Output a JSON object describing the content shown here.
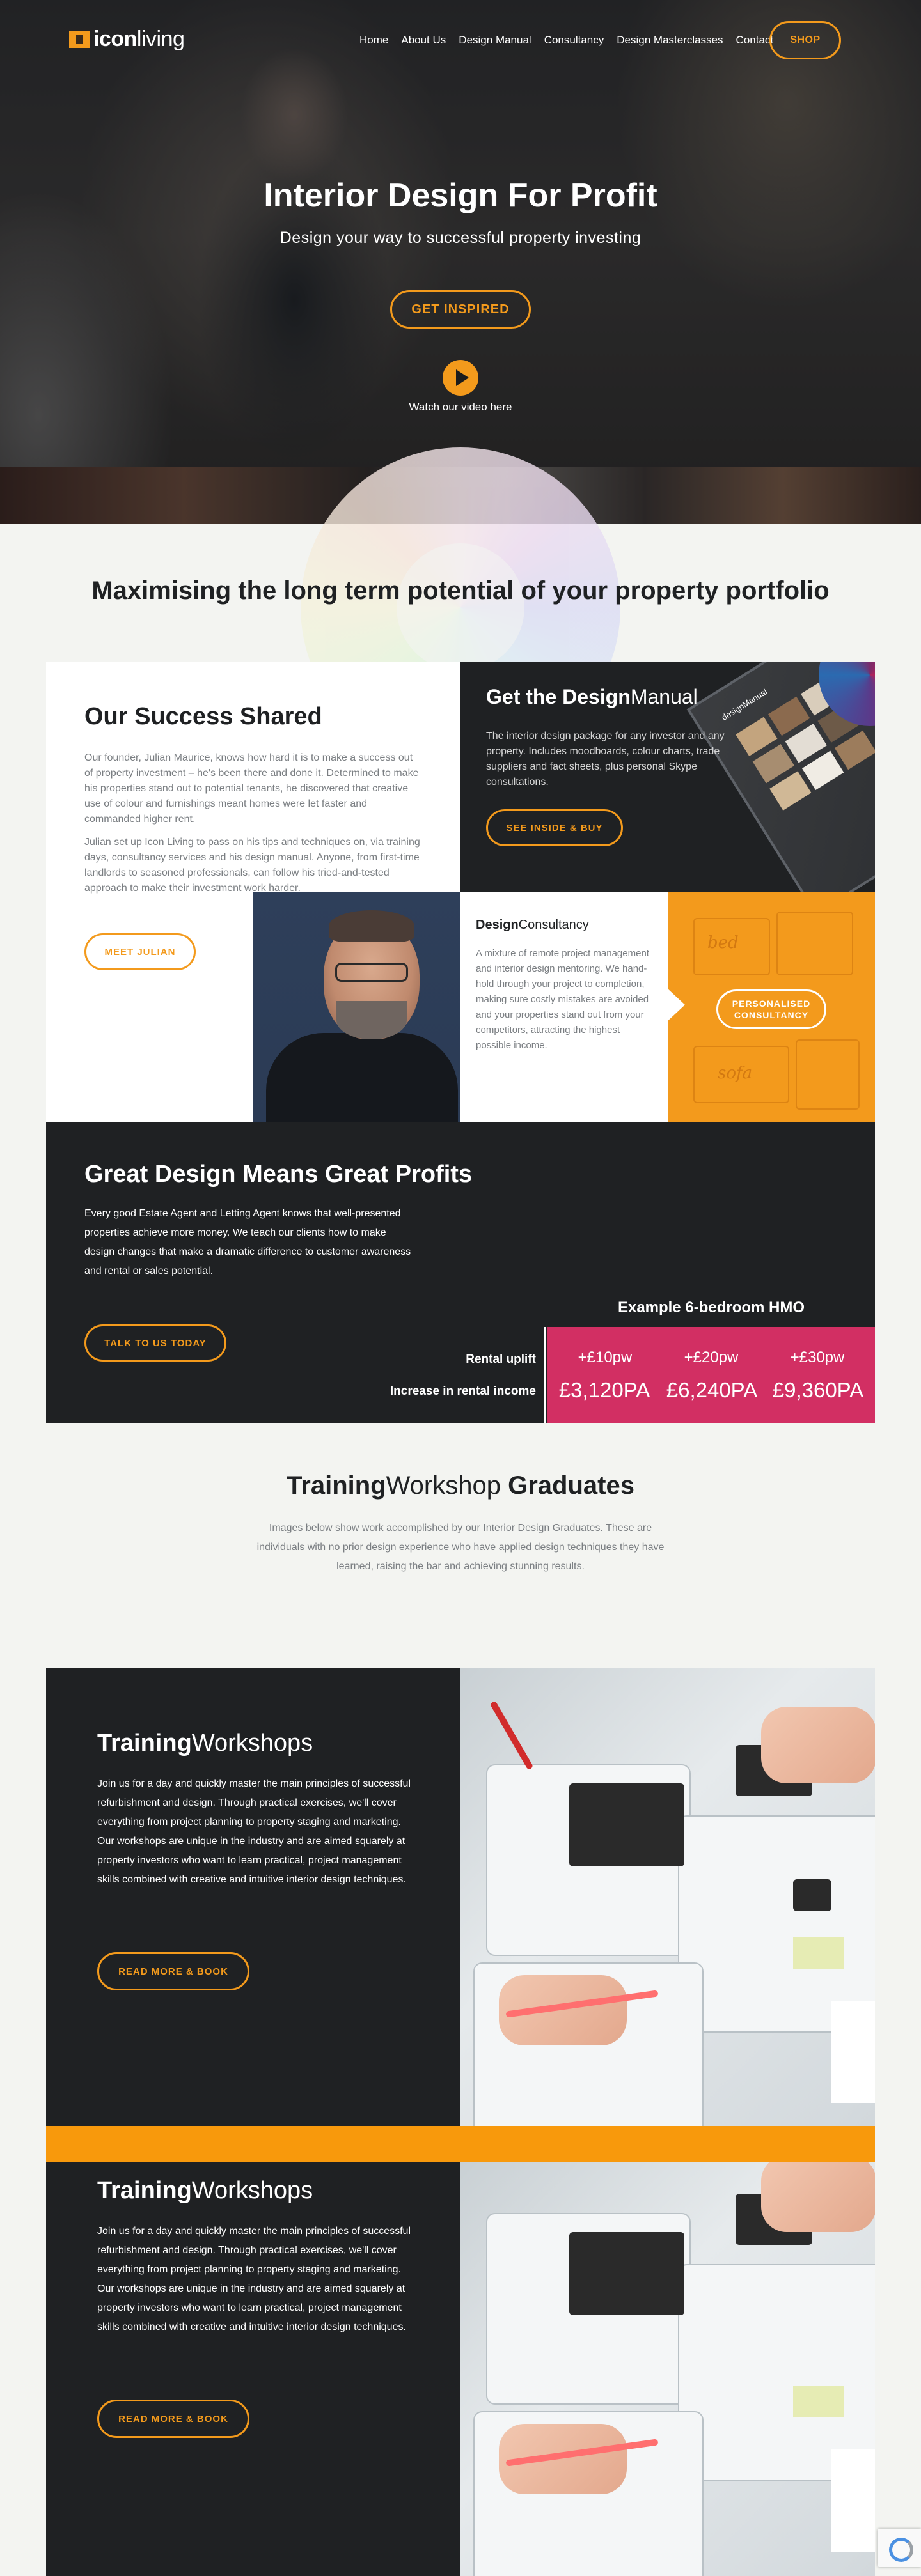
{
  "nav": {
    "brand_bold": "icon",
    "brand_light": "living",
    "links": [
      "Home",
      "About Us",
      "Design Manual",
      "Consultancy",
      "Design Masterclasses",
      "Contact"
    ],
    "shop": "SHOP"
  },
  "hero": {
    "title": "Interior Design For Profit",
    "subtitle": "Design your way to successful property investing",
    "cta": "GET INSPIRED",
    "video_text": "Watch our video here"
  },
  "intro": {
    "title": "Maximising the long term potential of your property portfolio"
  },
  "success": {
    "title": "Our Success Shared",
    "para1": "Our founder, Julian Maurice, knows how hard it is to make a success out of property investment – he's been there and done it. Determined to make his properties stand out to potential tenants, he discovered that creative use of colour and furnishings meant homes were let faster and commanded higher rent.",
    "para2": "Julian set up Icon Living to pass on his tips and techniques on, via training days, consultancy services and his design manual. Anyone, from first-time landlords to seasoned professionals, can follow his tried-and-tested approach to make their investment work harder.",
    "button": "MEET JULIAN"
  },
  "manual": {
    "title_bold": "Get the Design",
    "title_light": "Manual",
    "text": "The interior design package for any investor and any property. Includes moodboards, colour charts, trade suppliers and fact sheets, plus personal Skype consultations.",
    "button": "SEE INSIDE & BUY",
    "book_label": "designManual"
  },
  "consultancy": {
    "title_bold": "Design",
    "title_light": "Consultancy",
    "text": "A mixture of remote project management and interior design mentoring. We hand-hold through your project to completion, making sure costly mistakes are avoided and your properties stand out from your competitors, attracting the highest possible income.",
    "button_line1": "PERSONALISED",
    "button_line2": "CONSULTANCY",
    "sketch_words": [
      "bed",
      "sofa"
    ]
  },
  "profits": {
    "title": "Great Design Means Great Profits",
    "text": "Every good Estate Agent and Letting Agent knows that well-presented properties achieve more money. We teach our clients how to make design changes that make a dramatic difference to customer awareness and rental or sales potential.",
    "button": "TALK TO US TODAY",
    "example_title": "Example 6-bedroom HMO",
    "uplift_label": "Rental uplift",
    "increase_label": "Increase in rental income",
    "uplifts": [
      "+£10pw",
      "+£20pw",
      "+£30pw"
    ],
    "increases": [
      "£3,120PA",
      "£6,240PA",
      "£9,360PA"
    ],
    "highlight_color": "#d22f63"
  },
  "graduates": {
    "title_bold1": "Training",
    "title_light": "Workshop",
    "title_bold2": "Graduates",
    "text": "Images below show work accomplished by our Interior Design Graduates. These are individuals with no prior design experience who have applied design techniques they have learned, raising the bar and achieving stunning results."
  },
  "workshops": [
    {
      "title_bold": "Training",
      "title_light": "Workshops",
      "text": "Join us for a day and quickly master the main principles of successful refurbishment and design. Through practical exercises, we'll cover everything from project planning to property staging and marketing. Our workshops are unique in the industry and are aimed squarely at property investors who want to learn practical, project management skills combined with creative and intuitive interior design techniques.",
      "button": "READ MORE & BOOK"
    },
    {
      "title_bold": "Training",
      "title_light": "Workshops",
      "text": "Join us for a day and quickly master the main principles of successful refurbishment and design. Through practical exercises, we'll cover everything from project planning to property staging and marketing. Our workshops are unique in the industry and are aimed squarely at property investors who want to learn practical, project management skills combined with creative and intuitive interior design techniques.",
      "button": "READ MORE & BOOK"
    }
  ],
  "colors": {
    "accent": "#f39a1c",
    "dark": "#1f2123",
    "pink": "#d22f63",
    "background": "#f3f4f1"
  }
}
